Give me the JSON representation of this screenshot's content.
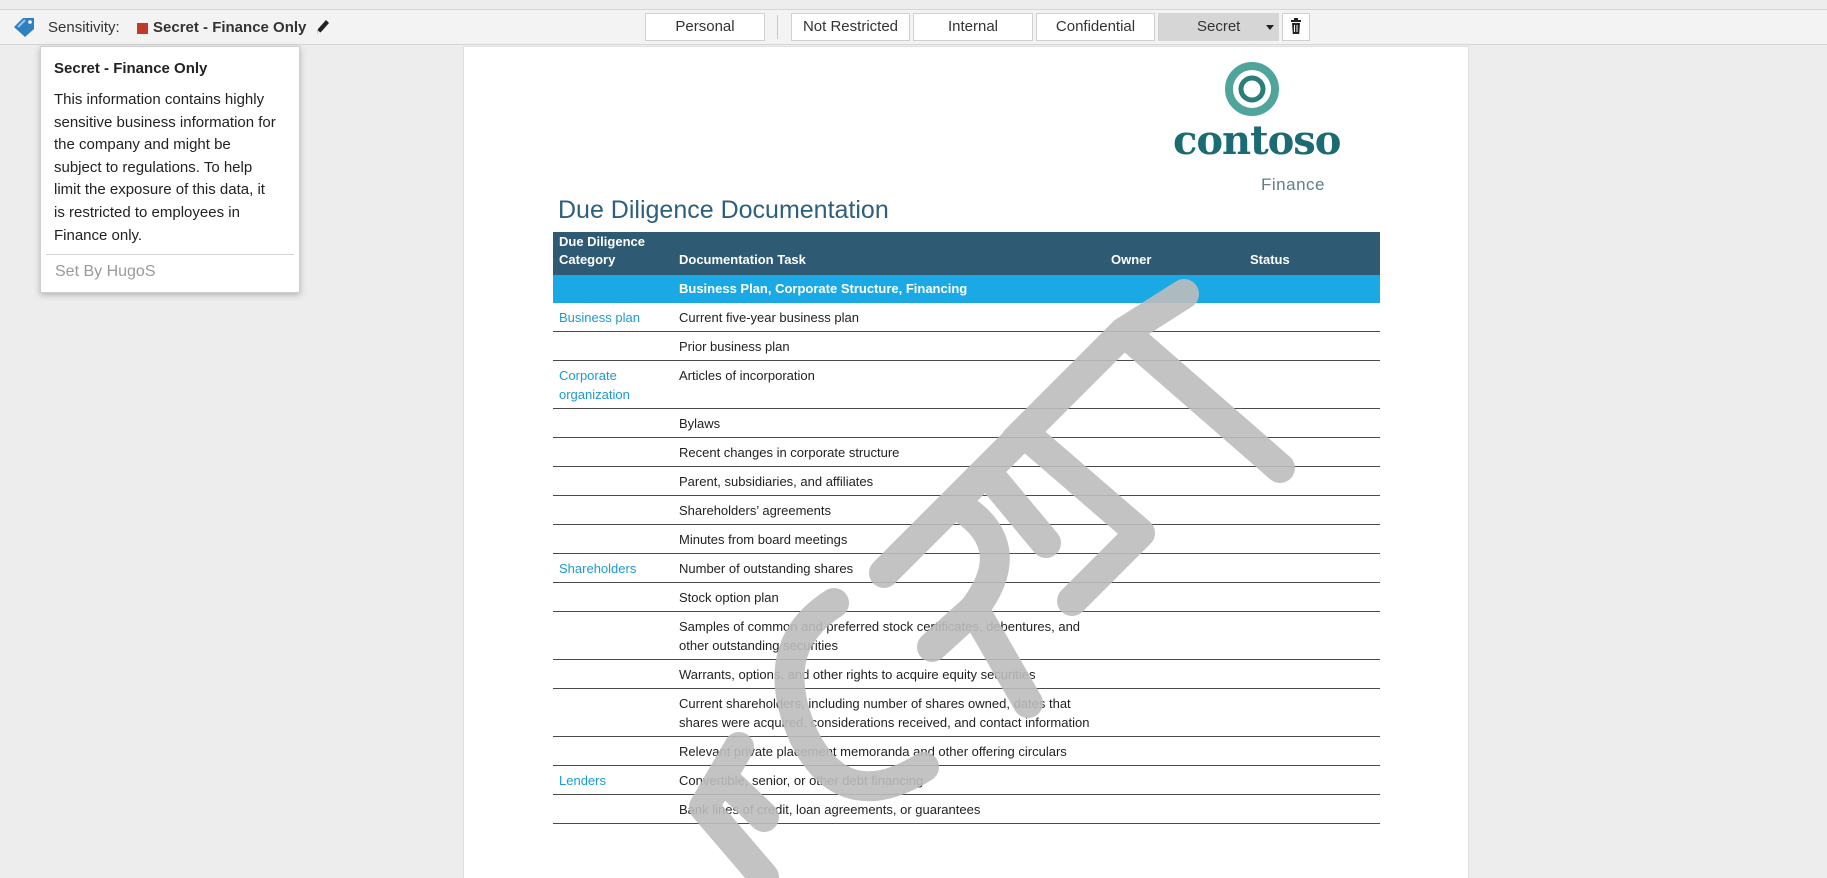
{
  "sensitivity_bar": {
    "label": "Sensitivity:",
    "current_label": "Secret - Finance Only",
    "label_color": "#c0392b",
    "levels": [
      {
        "label": "Personal",
        "selected": false
      },
      {
        "label": "Not Restricted",
        "selected": false
      },
      {
        "label": "Internal",
        "selected": false
      },
      {
        "label": "Confidential",
        "selected": false
      },
      {
        "label": "Secret",
        "selected": true
      }
    ],
    "icons": {
      "tag": "tag-icon",
      "edit": "pencil-icon",
      "dropdown": "caret-down-icon",
      "delete": "trash-icon"
    }
  },
  "tooltip": {
    "title": "Secret - Finance Only",
    "lines": [
      "This information contains highly",
      "sensitive business information for",
      "the company and might be",
      "subject to regulations. To help",
      "limit the exposure of this data, it",
      "is restricted to employees in",
      "Finance only."
    ],
    "set_by": "Set By HugoS"
  },
  "document": {
    "logo": {
      "name": "contoso",
      "sub": "Finance"
    },
    "title": "Due Diligence Documentation",
    "watermark": "SECRET",
    "table": {
      "headers": {
        "category_line1": "Due Diligence",
        "category_line2": "Category",
        "task": "Documentation Task",
        "owner": "Owner",
        "status": "Status"
      },
      "section": "Business Plan, Corporate Structure, Financing",
      "rows": [
        {
          "category": "Business plan",
          "task": "Current five-year business plan"
        },
        {
          "category": "",
          "task": "Prior business plan"
        },
        {
          "category": "Corporate organization",
          "task": "Articles of incorporation"
        },
        {
          "category": "",
          "task": "Bylaws"
        },
        {
          "category": "",
          "task": "Recent changes in corporate structure"
        },
        {
          "category": "",
          "task": "Parent, subsidiaries, and affiliates"
        },
        {
          "category": "",
          "task": "Shareholders’ agreements"
        },
        {
          "category": "",
          "task": "Minutes from board meetings"
        },
        {
          "category": "Shareholders",
          "task": "Number of outstanding shares"
        },
        {
          "category": "",
          "task": "Stock option plan"
        },
        {
          "category": "",
          "task": "Samples of common and preferred stock certificates, debentures, and other outstanding securities"
        },
        {
          "category": "",
          "task": "Warrants, options, and other rights to acquire equity securities"
        },
        {
          "category": "",
          "task": "Current shareholders, including number of shares owned, dates that shares were acquired, considerations received, and contact information"
        },
        {
          "category": "",
          "task": "Relevant private placement memoranda and other offering circulars"
        },
        {
          "category": "Lenders",
          "task": "Convertible, senior, or other debt financing"
        },
        {
          "category": "",
          "task": "Bank lines of credit, loan agreements, or guarantees"
        }
      ]
    }
  }
}
